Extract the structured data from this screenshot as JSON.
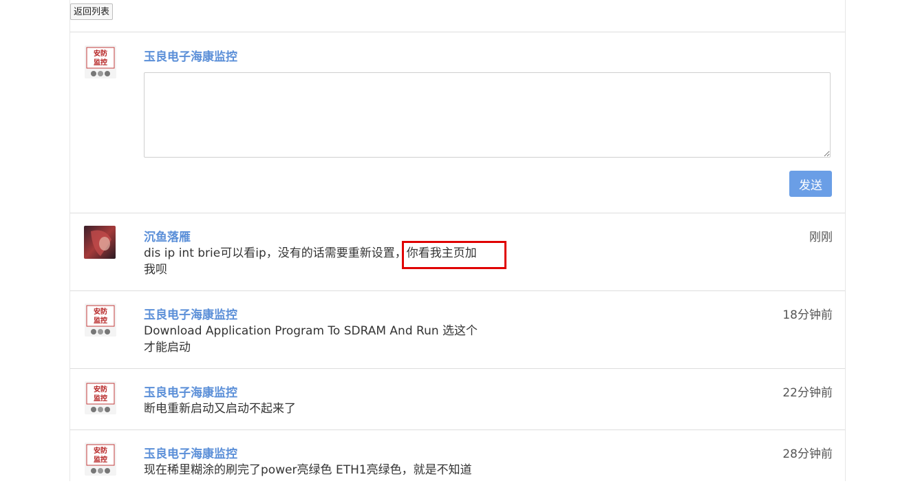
{
  "topbar": {
    "back_label": "返回列表"
  },
  "compose": {
    "author": "玉良电子海康监控",
    "send_label": "发送",
    "textarea_value": ""
  },
  "comments": [
    {
      "author": "沉鱼落雁",
      "time": "刚刚",
      "text_lines": [
        "dis ip int brie可以看ip，没有的话需要重新设置，你看我主页加",
        "我呗"
      ]
    },
    {
      "author": "玉良电子海康监控",
      "time": "18分钟前",
      "text_lines": [
        "Download Application Program To SDRAM And Run 选这个",
        "才能启动"
      ]
    },
    {
      "author": "玉良电子海康监控",
      "time": "22分钟前",
      "text_lines": [
        "断电重新启动又启动不起来了"
      ]
    },
    {
      "author": "玉良电子海康监控",
      "time": "28分钟前",
      "text_lines": [
        "现在稀里糊涂的刷完了power亮绿色 ETH1亮绿色，就是不知道"
      ]
    }
  ],
  "avatars": {
    "security_logo_text": [
      "安防",
      "监控"
    ]
  },
  "colors": {
    "name_blue": "#5b8fd8",
    "send_button": "#6a9ee6",
    "highlight_red": "#e00000"
  }
}
